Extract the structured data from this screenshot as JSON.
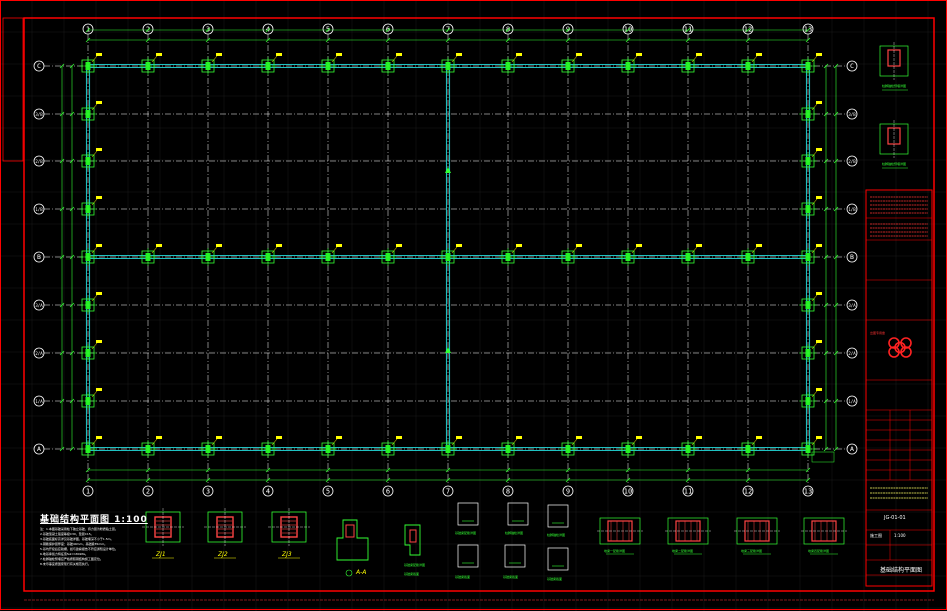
{
  "drawing": {
    "title": "基础结构平面图 1:100",
    "notes": [
      "注：1.本图基础采用柱下独立基础，持力层为粉质粘土层。",
      "2.基础混凝土强度等级C30，垫层C15。",
      "3.基础底面标高详见基础详图，基础埋深不小于1.5m。",
      "4.钢筋保护层厚度：基础40mm，基础梁35mm。",
      "5.基坑开挖后应验槽，如与勘察报告不符应通知设计单位。",
      "6.地基承载力特征值fak=180kPa。",
      "7.柱脚锚栓预埋应严格按照钢结构施工图定位。",
      "8.未尽事宜按国家现行有关规范执行。"
    ],
    "grid_columns": [
      "1",
      "2",
      "3",
      "4",
      "5",
      "6",
      "7",
      "8",
      "9",
      "10",
      "11",
      "12",
      "13"
    ],
    "grid_rows": [
      "C",
      "2/B",
      "1/B",
      "B",
      "2/A",
      "1/A",
      "A"
    ],
    "grid_rows_extra": [
      "3/B"
    ],
    "foundation_details": [
      "ZJ1",
      "ZJ2",
      "ZJ3"
    ],
    "section_label": "A-A",
    "detail_captions": [
      "基础梁配筋详图",
      "基础梁配筋详图",
      "柱脚锚栓详图",
      "柱脚锚栓详图",
      "基础梁截面",
      "基础梁截面",
      "基础梁截面",
      "基础梁截面"
    ],
    "beam_details": [
      "地梁一配筋详图",
      "地梁二配筋详图",
      "地梁三配筋详图",
      "地梁四配筋详图"
    ],
    "top_right_captions": [
      "柱脚锚栓预埋详图",
      "柱脚锚栓预埋详图"
    ]
  },
  "title_block": {
    "drawing_name": "基础结构平面图",
    "drawing_no": "JG-01-01",
    "stage": "施工图",
    "scale": "1:100",
    "stamp_label": "出图专用章"
  },
  "colors": {
    "border": "#ff0000",
    "grid": "#33ff33",
    "beam": "#22dddd",
    "axis": "#ffffff",
    "tag": "#ffff00"
  }
}
